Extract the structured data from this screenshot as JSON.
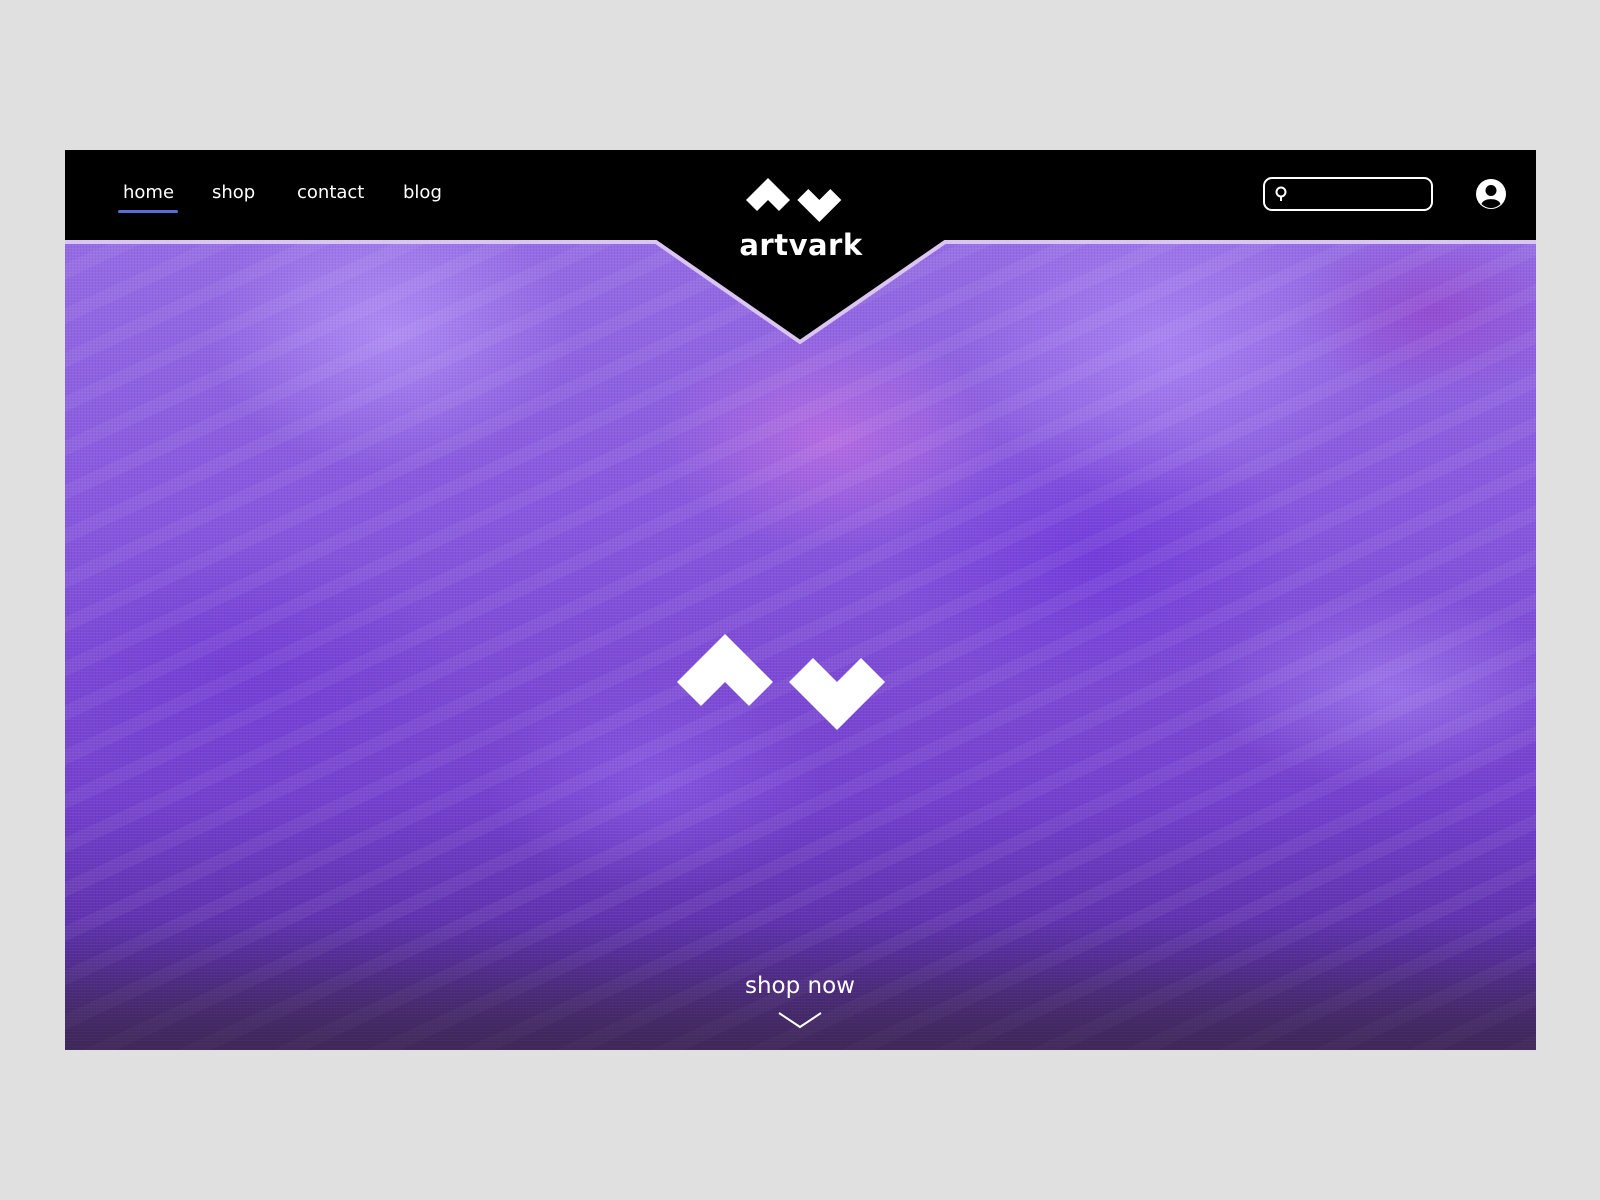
{
  "nav": {
    "items": [
      {
        "label": "home",
        "active": true
      },
      {
        "label": "shop",
        "active": false
      },
      {
        "label": "contact",
        "active": false
      },
      {
        "label": "blog",
        "active": false
      }
    ]
  },
  "brand": {
    "name": "artvark",
    "logo_icon": "artvark-logo-icon"
  },
  "search": {
    "placeholder": "",
    "value": "",
    "icon": "search-icon"
  },
  "account": {
    "icon": "user-account-icon"
  },
  "hero": {
    "cta_label": "shop now",
    "cta_icon": "chevron-down-icon"
  },
  "colors": {
    "header_bg": "#000000",
    "header_border": "#d9c6f2",
    "nav_active_underline": "#5b6bd6",
    "hero_purple": "#7c4fd6",
    "page_bg": "#e0e0e0",
    "text": "#ffffff"
  }
}
